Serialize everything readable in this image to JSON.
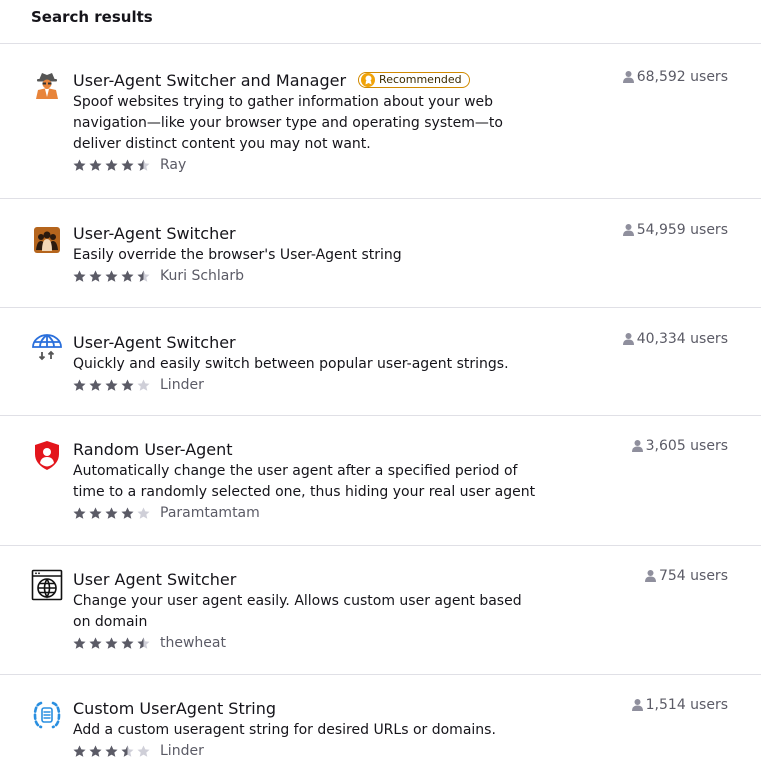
{
  "header": {
    "title": "Search results"
  },
  "results": [
    {
      "title": "User-Agent Switcher and Manager",
      "badge": "Recommended",
      "description": "Spoof websites trying to gather information about your web navigation—like your browser type and operating system—to deliver distinct content you may not want.",
      "rating": 4.5,
      "author": "Ray",
      "users": "68,592 users",
      "icon": "spy-agent-icon"
    },
    {
      "title": "User-Agent Switcher",
      "description": "Easily override the browser's User-Agent string",
      "rating": 4.5,
      "author": "Kuri Schlarb",
      "users": "54,959 users",
      "icon": "people-group-icon"
    },
    {
      "title": "User-Agent Switcher",
      "description": "Quickly and easily switch between popular user-agent strings.",
      "rating": 4,
      "author": "Linder",
      "users": "40,334 users",
      "icon": "globe-switch-icon"
    },
    {
      "title": "Random User-Agent",
      "description": "Automatically change the user agent after a specified period of time to a randomly selected one, thus hiding your real user agent",
      "rating": 4,
      "author": "Paramtamtam",
      "users": "3,605 users",
      "icon": "shield-user-icon"
    },
    {
      "title": "User Agent Switcher",
      "description": "Change your user agent easily. Allows custom user agent based on domain",
      "rating": 4.5,
      "author": "thewheat",
      "users": "754 users",
      "icon": "browser-globe-icon"
    },
    {
      "title": "Custom UserAgent String",
      "description": "Add a custom useragent string for desired URLs or domains.",
      "rating": 3.5,
      "author": "Linder",
      "users": "1,514 users",
      "icon": "code-brackets-icon"
    }
  ],
  "colors": {
    "star_filled": "#5b5b66",
    "star_empty": "#cfcfd8",
    "badge_border": "#d18a00",
    "badge_fill": "#f0a30a"
  }
}
